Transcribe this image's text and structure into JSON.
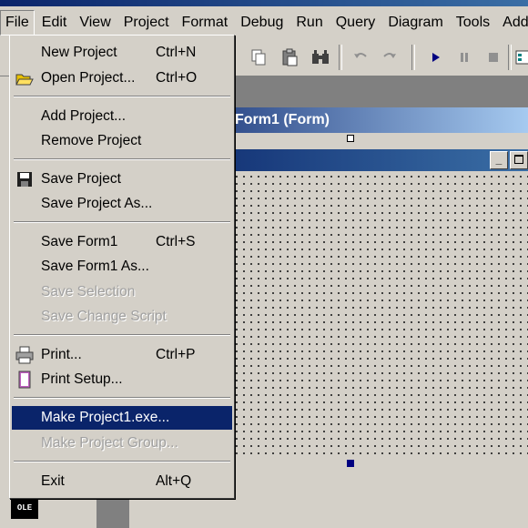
{
  "menubar": {
    "items": [
      "File",
      "Edit",
      "View",
      "Project",
      "Format",
      "Debug",
      "Run",
      "Query",
      "Diagram",
      "Tools",
      "Add-"
    ]
  },
  "form": {
    "title": "Form1 (Form)",
    "minimize": "_"
  },
  "toolbox": {
    "ole_label": "OLE"
  },
  "file_menu": {
    "items": [
      {
        "label": "New Project",
        "shortcut": "Ctrl+N"
      },
      {
        "label": "Open Project...",
        "shortcut": "Ctrl+O"
      },
      {
        "label": "Add Project...",
        "shortcut": ""
      },
      {
        "label": "Remove Project",
        "shortcut": ""
      },
      {
        "label": "Save Project",
        "shortcut": ""
      },
      {
        "label": "Save Project As...",
        "shortcut": ""
      },
      {
        "label": "Save Form1",
        "shortcut": "Ctrl+S"
      },
      {
        "label": "Save Form1 As...",
        "shortcut": ""
      },
      {
        "label": "Save Selection",
        "shortcut": ""
      },
      {
        "label": "Save Change Script",
        "shortcut": ""
      },
      {
        "label": "Print...",
        "shortcut": "Ctrl+P"
      },
      {
        "label": "Print Setup...",
        "shortcut": ""
      },
      {
        "label": "Make Project1.exe...",
        "shortcut": ""
      },
      {
        "label": "Make Project Group...",
        "shortcut": ""
      },
      {
        "label": "Exit",
        "shortcut": "Alt+Q"
      }
    ]
  },
  "colors": {
    "highlight": "#0a246a",
    "face": "#d4d0c8",
    "disabled": "#a0a0a0"
  }
}
